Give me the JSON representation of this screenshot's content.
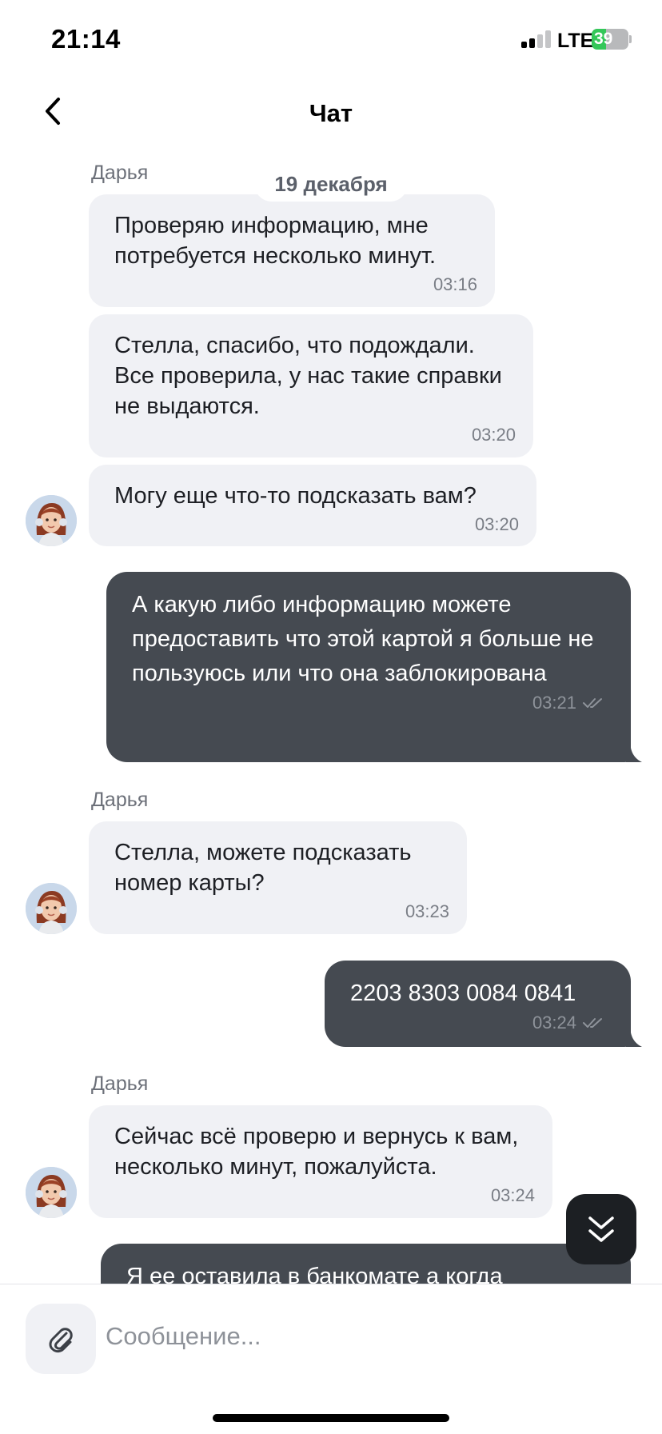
{
  "status_bar": {
    "time": "21:14",
    "network": "LTE",
    "battery": "39",
    "battery_level": 0.39
  },
  "header": {
    "title": "Чат"
  },
  "chat": {
    "date_divider": "19 декабря",
    "messages": [
      {
        "sender": "Дарья",
        "text": "Проверяю информацию, мне потребуется несколько минут.",
        "time": "03:16"
      },
      {
        "text": "Стелла, спасибо, что подождали. Все проверила, у нас такие справки не выдаются.",
        "time": "03:20"
      },
      {
        "text": "Могу еще что-то подсказать вам?",
        "time": "03:20"
      },
      {
        "text": "А какую либо информацию можете предоставить что этой картой я больше не пользуюсь или что она заблокирована",
        "time": "03:21"
      },
      {
        "sender": "Дарья",
        "text": "Стелла, можете подсказать номер карты?",
        "time": "03:23"
      },
      {
        "text": "2203 8303 0084 0841",
        "time": "03:24"
      },
      {
        "sender": "Дарья",
        "text": "Сейчас всё проверю и вернусь к вам, несколько минут, пожалуйста.",
        "time": "03:24"
      },
      {
        "text": "Я ее оставила в банкомате а когда"
      }
    ]
  },
  "composer": {
    "placeholder": "Сообщение..."
  },
  "icons": {
    "back": "chevron-left-icon",
    "attach": "paperclip-icon",
    "scroll_down": "double-chevron-down-icon",
    "read": "double-check-icon",
    "avatar": "agent-avatar"
  },
  "colors": {
    "incoming_bubble": "#f0f1f5",
    "outgoing_bubble": "#454a51",
    "link": "#1a7ef0",
    "battery_green": "#34c759"
  }
}
